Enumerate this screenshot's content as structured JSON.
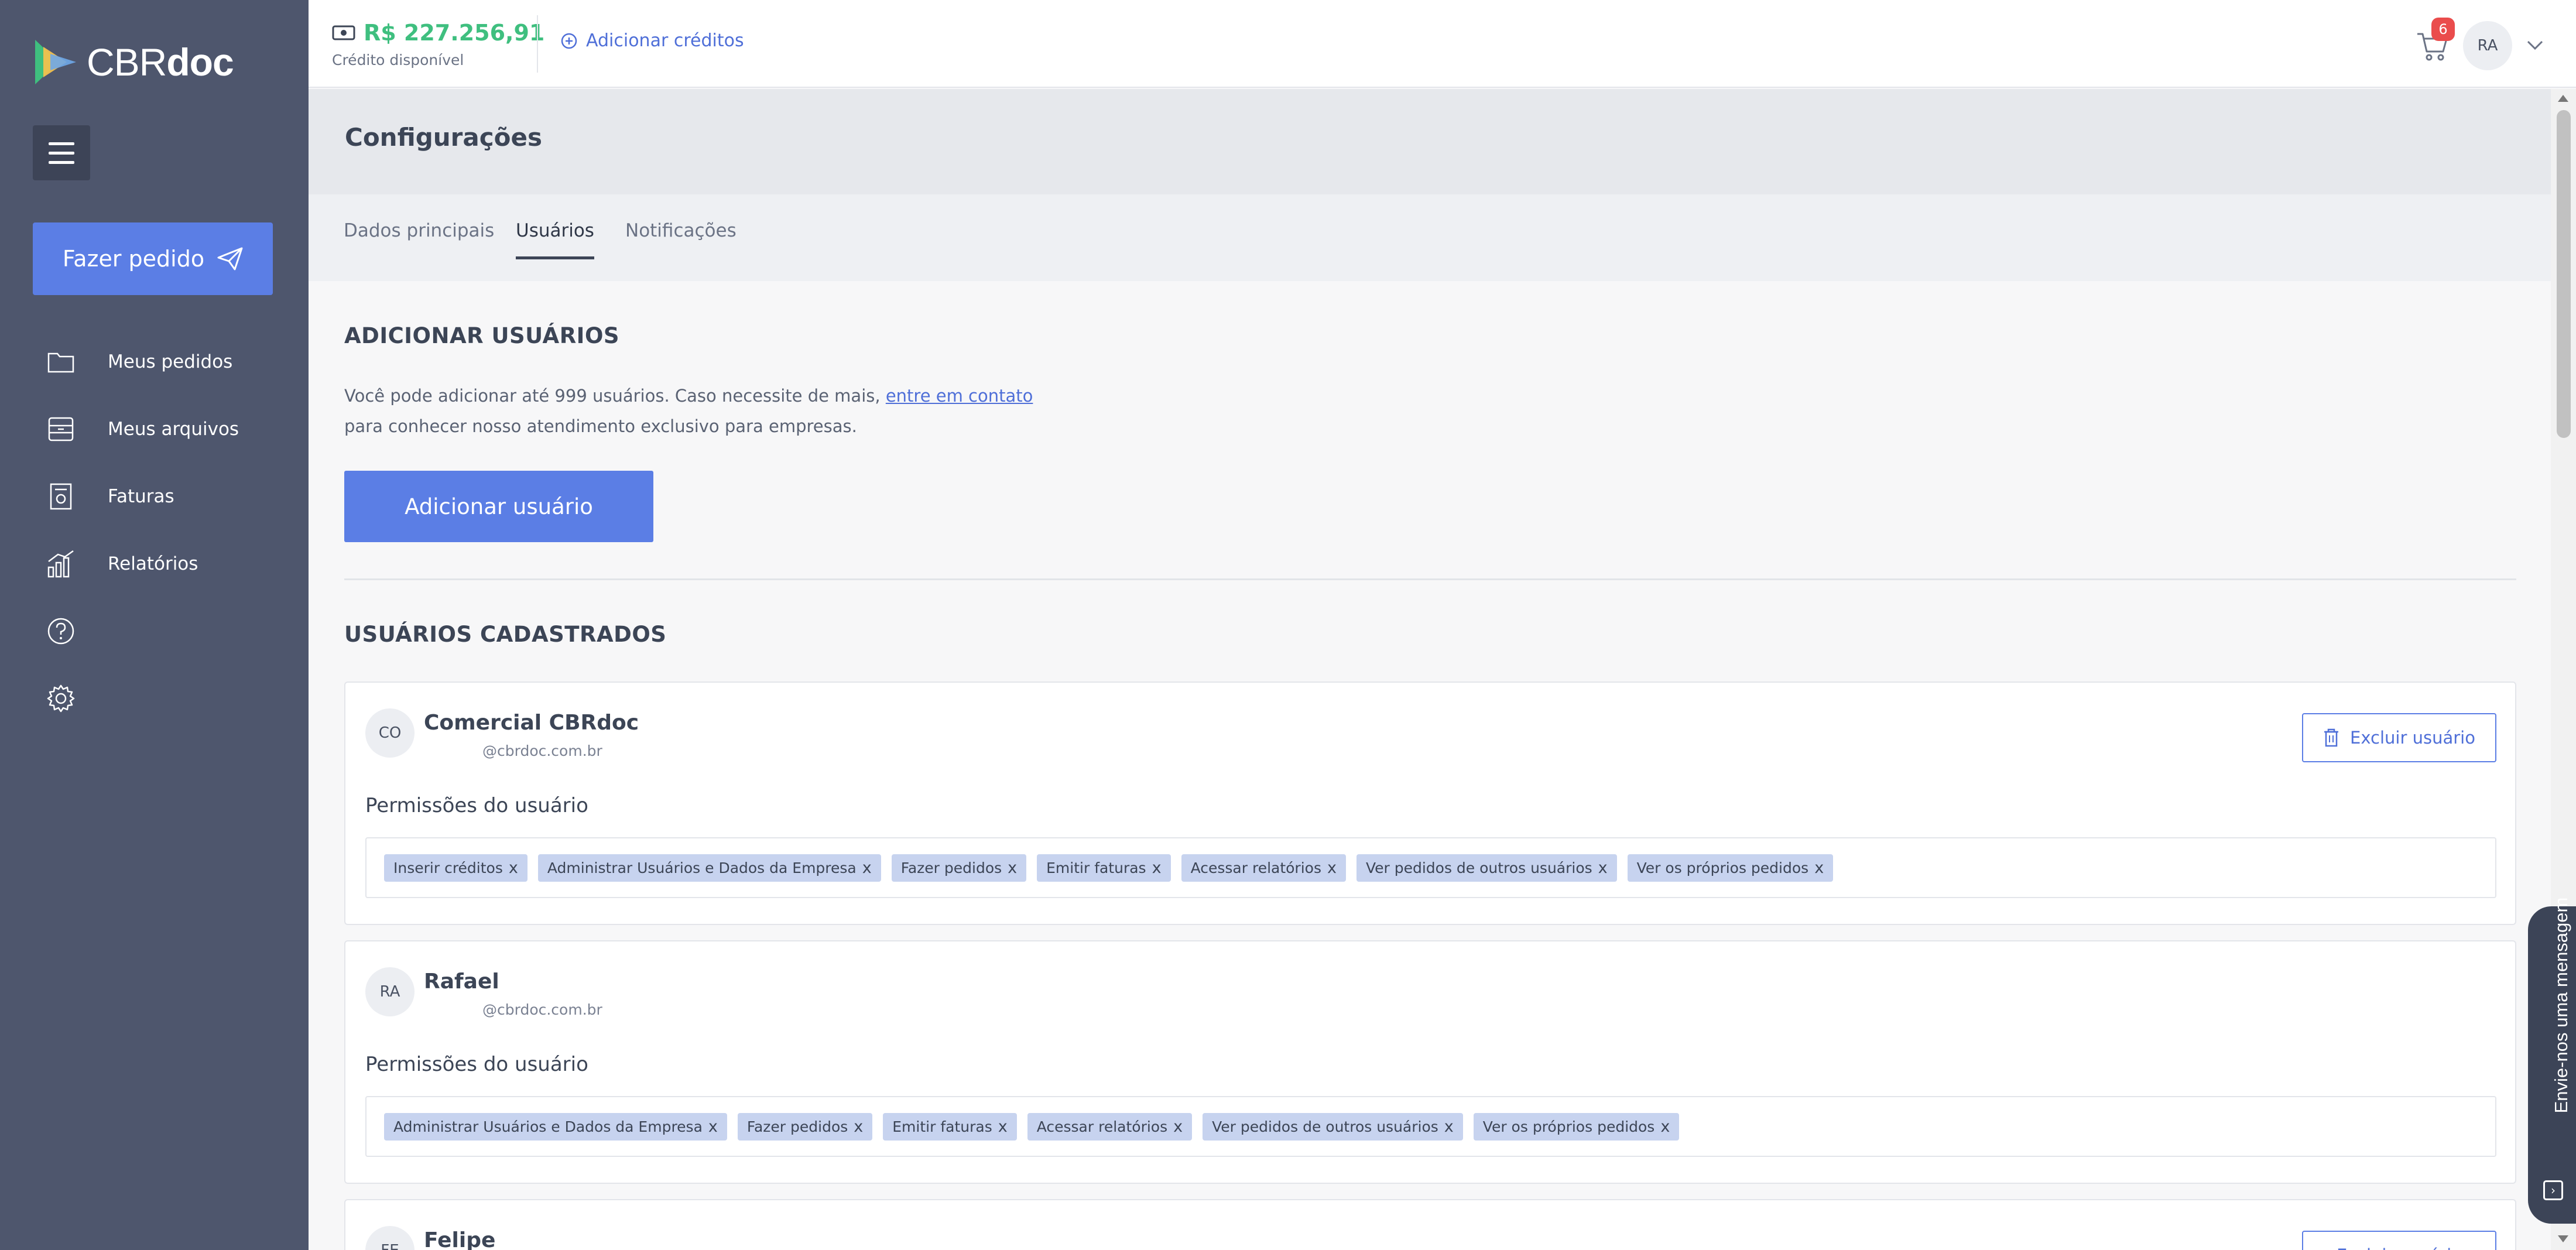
{
  "brand": {
    "name_light": "CBR",
    "name_bold": "doc"
  },
  "sidebar": {
    "order_button": "Fazer pedido",
    "items": [
      {
        "label": "Meus pedidos",
        "icon": "folder-icon"
      },
      {
        "label": "Meus arquivos",
        "icon": "archive-icon"
      },
      {
        "label": "Faturas",
        "icon": "invoice-icon"
      },
      {
        "label": "Relatórios",
        "icon": "reports-icon"
      }
    ],
    "help_icon": "help-icon",
    "settings_icon": "settings-icon"
  },
  "topbar": {
    "credit_amount": "R$ 227.256,91",
    "credit_label": "Crédito disponível",
    "add_credits": "Adicionar créditos",
    "cart_count": "6",
    "avatar": "RA"
  },
  "page": {
    "title": "Configurações",
    "tabs": [
      "Dados principais",
      "Usuários",
      "Notificações"
    ],
    "active_tab": "Usuários"
  },
  "add_users": {
    "heading": "ADICIONAR USUÁRIOS",
    "text_before": "Você pode adicionar até 999 usuários. Caso necessite de mais, ",
    "link": "entre em contato",
    "text_after": " para conhecer nosso atendimento exclusivo para empresas.",
    "button": "Adicionar usuário"
  },
  "registered": {
    "heading": "USUÁRIOS CADASTRADOS",
    "permissions_label": "Permissões do usuário",
    "delete_label": "Excluir usuário",
    "remove_mark": "x",
    "users": [
      {
        "initials": "CO",
        "name": "Comercial CBRdoc",
        "email": "@cbrdoc.com.br",
        "permissions": [
          "Inserir créditos",
          "Administrar Usuários e Dados da Empresa",
          "Fazer pedidos",
          "Emitir faturas",
          "Acessar relatórios",
          "Ver pedidos de outros usuários",
          "Ver os próprios pedidos"
        ]
      },
      {
        "initials": "RA",
        "name": "Rafael",
        "email": "@cbrdoc.com.br",
        "permissions": [
          "Administrar Usuários e Dados da Empresa",
          "Fazer pedidos",
          "Emitir faturas",
          "Acessar relatórios",
          "Ver pedidos de outros usuários",
          "Ver os próprios pedidos"
        ]
      },
      {
        "initials": "FE",
        "name": "Felipe",
        "email": "",
        "permissions": []
      }
    ]
  },
  "chat": {
    "label": "Envie-nos uma mensagem"
  },
  "colors": {
    "sidebar": "#4e566d",
    "accent": "#5b7ee5",
    "credit": "#3fbf7f",
    "badge": "#ea4c4c",
    "chip": "#c7d3ef"
  }
}
